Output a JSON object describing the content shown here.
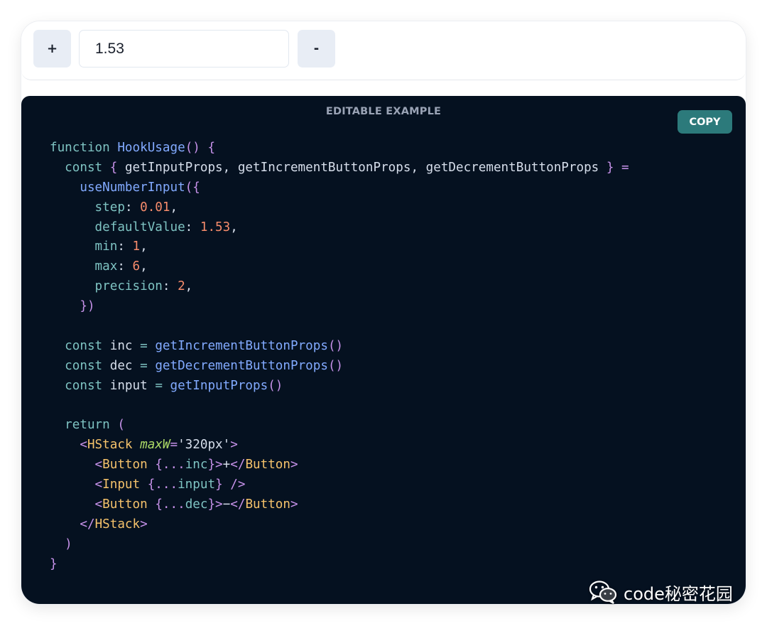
{
  "preview": {
    "increment_label": "+",
    "input_value": "1.53",
    "decrement_label": "-"
  },
  "editor": {
    "label": "EDITABLE EXAMPLE",
    "copy_label": "COPY",
    "code_lines": [
      [
        [
          "kw",
          "function "
        ],
        [
          "fn",
          "HookUsage"
        ],
        [
          "pr",
          "() {"
        ]
      ],
      [
        [
          "kw",
          "  const "
        ],
        [
          "pr",
          "{ "
        ],
        [
          "pl",
          "getInputProps, getIncrementButtonProps, getDecrementButtonProps "
        ],
        [
          "pr",
          "} ="
        ]
      ],
      [
        [
          "fn",
          "    useNumberInput"
        ],
        [
          "pr",
          "({"
        ]
      ],
      [
        [
          "kw",
          "      step"
        ],
        [
          "pl",
          ": "
        ],
        [
          "nm",
          "0.01"
        ],
        [
          "pl",
          ","
        ]
      ],
      [
        [
          "kw",
          "      defaultValue"
        ],
        [
          "pl",
          ": "
        ],
        [
          "nm",
          "1.53"
        ],
        [
          "pl",
          ","
        ]
      ],
      [
        [
          "kw",
          "      min"
        ],
        [
          "pl",
          ": "
        ],
        [
          "nm",
          "1"
        ],
        [
          "pl",
          ","
        ]
      ],
      [
        [
          "kw",
          "      max"
        ],
        [
          "pl",
          ": "
        ],
        [
          "nm",
          "6"
        ],
        [
          "pl",
          ","
        ]
      ],
      [
        [
          "kw",
          "      precision"
        ],
        [
          "pl",
          ": "
        ],
        [
          "nm",
          "2"
        ],
        [
          "pl",
          ","
        ]
      ],
      [
        [
          "pr",
          "    })"
        ]
      ],
      [],
      [
        [
          "kw",
          "  const "
        ],
        [
          "pl",
          "inc "
        ],
        [
          "kw",
          "= "
        ],
        [
          "fn",
          "getIncrementButtonProps"
        ],
        [
          "pr",
          "()"
        ]
      ],
      [
        [
          "kw",
          "  const "
        ],
        [
          "pl",
          "dec "
        ],
        [
          "kw",
          "= "
        ],
        [
          "fn",
          "getDecrementButtonProps"
        ],
        [
          "pr",
          "()"
        ]
      ],
      [
        [
          "kw",
          "  const "
        ],
        [
          "pl",
          "input "
        ],
        [
          "kw",
          "= "
        ],
        [
          "fn",
          "getInputProps"
        ],
        [
          "pr",
          "()"
        ]
      ],
      [],
      [
        [
          "kw",
          "  return "
        ],
        [
          "pr",
          "("
        ]
      ],
      [
        [
          "pr",
          "    <"
        ],
        [
          "tg",
          "HStack "
        ],
        [
          "at",
          "maxW"
        ],
        [
          "pr",
          "="
        ],
        [
          "pl",
          "'320px'"
        ],
        [
          "pr",
          ">"
        ]
      ],
      [
        [
          "pr",
          "      <"
        ],
        [
          "tg",
          "Button "
        ],
        [
          "pr",
          "{..."
        ],
        [
          "kw",
          "inc"
        ],
        [
          "pr",
          "}>"
        ],
        [
          "pl",
          "+"
        ],
        [
          "pr",
          "</"
        ],
        [
          "tg",
          "Button"
        ],
        [
          "pr",
          ">"
        ]
      ],
      [
        [
          "pr",
          "      <"
        ],
        [
          "tg",
          "Input "
        ],
        [
          "pr",
          "{..."
        ],
        [
          "kw",
          "input"
        ],
        [
          "pr",
          "} />"
        ]
      ],
      [
        [
          "pr",
          "      <"
        ],
        [
          "tg",
          "Button "
        ],
        [
          "pr",
          "{..."
        ],
        [
          "kw",
          "dec"
        ],
        [
          "pr",
          "}>"
        ],
        [
          "pl",
          "−"
        ],
        [
          "pr",
          "</"
        ],
        [
          "tg",
          "Button"
        ],
        [
          "pr",
          ">"
        ]
      ],
      [
        [
          "pr",
          "    </"
        ],
        [
          "tg",
          "HStack"
        ],
        [
          "pr",
          ">"
        ]
      ],
      [
        [
          "pr",
          "  )"
        ]
      ],
      [
        [
          "pr",
          "}"
        ]
      ]
    ]
  },
  "watermark": {
    "icon": "wechat-icon",
    "text": "code秘密花园"
  }
}
